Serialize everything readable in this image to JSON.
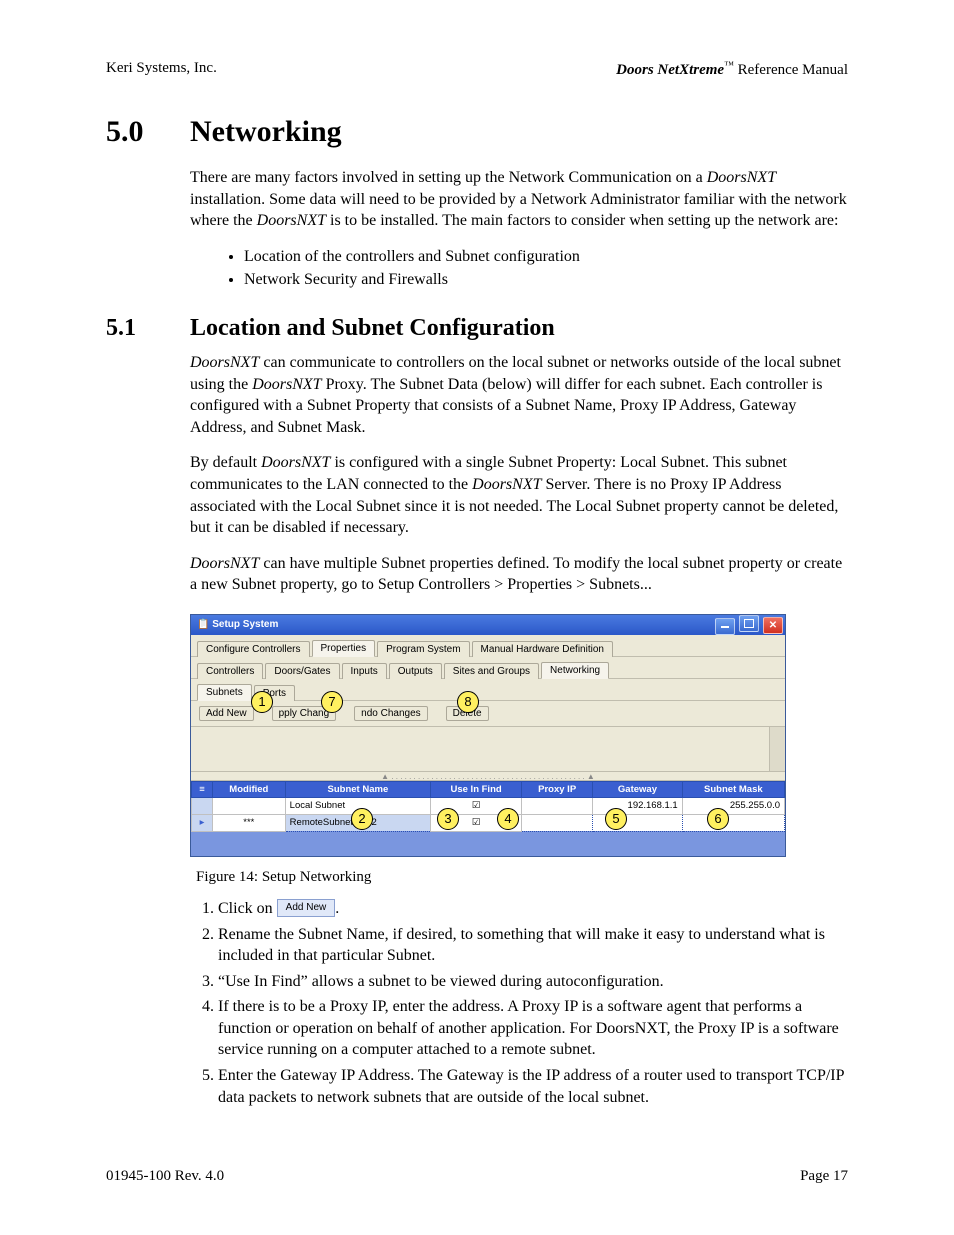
{
  "header": {
    "left": "Keri Systems, Inc.",
    "product": "Doors NetXtreme",
    "tm": "™",
    "right_suffix": " Reference Manual"
  },
  "h1": {
    "num": "5.0",
    "title": "Networking"
  },
  "intro": {
    "p1a": "There are many factors involved in setting up the Network Communication on a ",
    "p1b": "DoorsNXT",
    "p1c": " installation. Some data will need to be provided by a Network Administrator familiar with the network where the ",
    "p1d": "DoorsNXT",
    "p1e": " is to be installed. The main factors to consider when setting up the network are:",
    "bullets": [
      "Location of the controllers and Subnet configuration",
      "Network Security and Firewalls"
    ]
  },
  "h2": {
    "num": "5.1",
    "title": "Location and Subnet Configuration"
  },
  "sec51": {
    "p1a": "DoorsNXT",
    "p1b": " can communicate to controllers on the local subnet or networks outside of the local subnet using the ",
    "p1c": "DoorsNXT",
    "p1d": " Proxy. The Subnet Data (below) will differ for each subnet. Each controller is configured with a Subnet Property that consists of a Subnet Name, Proxy IP Address, Gateway Address, and Subnet Mask.",
    "p2a": "By default ",
    "p2b": "DoorsNXT",
    "p2c": " is configured with a single Subnet Property: Local Subnet. This subnet communicates to the LAN connected to the ",
    "p2d": "DoorsNXT",
    "p2e": " Server. There is no Proxy IP Address associated with the Local Subnet since it is not needed. The Local Subnet property cannot be deleted, but it can be disabled if necessary.",
    "p3a": "DoorsNXT",
    "p3b": " can have multiple Subnet properties defined. To modify the local subnet property or create a new Subnet property, go to Setup Controllers > Properties > Subnets..."
  },
  "window": {
    "title": "Setup System",
    "menubar": [
      "Configure Controllers",
      "Properties",
      "Program System",
      "Manual Hardware Definition"
    ],
    "menubar_active": "Properties",
    "tabs": [
      "Controllers",
      "Doors/Gates",
      "Inputs",
      "Outputs",
      "Sites and Groups",
      "Networking"
    ],
    "tabs_active": "Networking",
    "subtabs": [
      "Subnets",
      "Ports"
    ],
    "subtabs_active": "Subnets",
    "toolbar": {
      "add": "Add New",
      "apply": "pply Chang",
      "undo": "ndo Changes",
      "delete": "Delete"
    },
    "splitter_hint": "▲ . . . . . . . . . . . . . . . . . . . . . . . . . . . . . . . . . . . . . . . . . . . . ▲",
    "grid": {
      "columns": [
        "Modified",
        "Subnet Name",
        "Use In Find",
        "Proxy IP",
        "Gateway",
        "Subnet Mask"
      ],
      "rows": [
        {
          "rowhdr": "",
          "modified": "",
          "name": "Local Subnet",
          "find": true,
          "proxy": "",
          "gateway": "192.168.1.1",
          "mask": "255.255.0.0",
          "editing": false
        },
        {
          "rowhdr": "▸",
          "modified": "***",
          "name": "RemoteSubnet 3302",
          "find": true,
          "proxy": "",
          "gateway": "",
          "mask": "",
          "editing": true
        }
      ]
    },
    "callouts": {
      "1": "1",
      "2": "2",
      "3": "3",
      "4": "4",
      "5": "5",
      "6": "6",
      "7": "7",
      "8": "8"
    }
  },
  "caption": "Figure 14: Setup Networking",
  "steps": {
    "s1a": "Click on ",
    "s1_btn": "Add New",
    "s1b": ".",
    "s2": "Rename the Subnet Name, if desired, to something that will make it easy to understand what is included in that particular Subnet.",
    "s3": "“Use In Find” allows a subnet to be viewed during autoconfiguration.",
    "s4a": "If there is to be a Proxy IP, enter the address. A Proxy IP is a software agent that performs a function or operation on behalf of another application. For ",
    "s4b": "DoorsNXT",
    "s4c": ", the Proxy IP is a software service running on a computer attached to a remote subnet.",
    "s5": "Enter the Gateway IP Address. The Gateway is the IP address of a router used to transport TCP/IP data packets to network subnets that are outside of the local subnet."
  },
  "footer": {
    "left": "01945-100  Rev. 4.0",
    "right": "Page 17"
  }
}
